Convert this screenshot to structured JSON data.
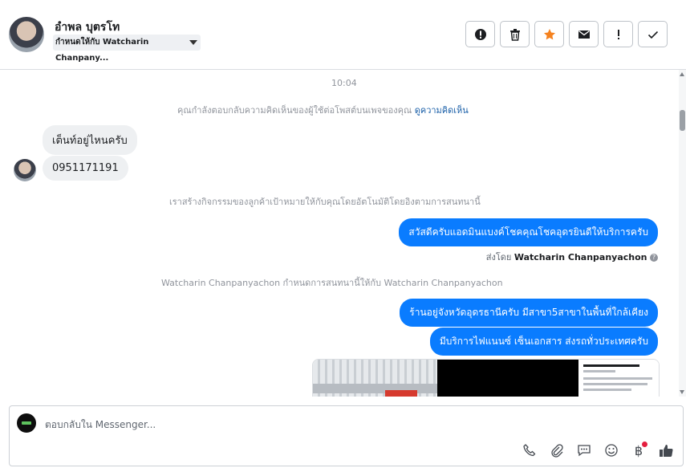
{
  "header": {
    "contact_name": "อำพล บุตรโท",
    "assign_label": "กำหนดให้กับ Watcharin Chanpany...",
    "actions": [
      {
        "name": "spam-button",
        "icon": "alert-circle-icon"
      },
      {
        "name": "delete-button",
        "icon": "trash-icon"
      },
      {
        "name": "follow-up-button",
        "icon": "star-icon"
      },
      {
        "name": "mark-unread-button",
        "icon": "envelope-icon"
      },
      {
        "name": "important-button",
        "icon": "exclamation-icon"
      },
      {
        "name": "done-button",
        "icon": "checkmark-icon"
      }
    ]
  },
  "thread": {
    "timestamp": "10:04",
    "reply_note": "คุณกำลังตอบกลับความคิดเห็นของผู้ใช้ต่อโพสต์บนเพจของคุณ",
    "reply_note_link": "ดูความคิดเห็น",
    "incoming": [
      "เต็นท์อยู่ไหนครับ",
      "0951171191"
    ],
    "activity_note": "เราสร้างกิจกรรมของลูกค้าเป้าหมายให้กับคุณโดยอัตโนมัติโดยอิงตามการสนทนานี้",
    "outgoing_first": "สวัสดีครับแอดมินแบงค์โชคคุณโชคอุดรยินดีให้บริการครับ",
    "sent_by_prefix": "ส่งโดย",
    "sent_by_name": "Watcharin Chanpanyachon",
    "assign_note": "Watcharin Chanpanyachon กำหนดการสนทนานี้ให้กับ Watcharin Chanpanyachon",
    "outgoing_second": "ร้านอยู่จังหวัดอุดรธานีครับ มีสาขา5สาขาในพื้นที่ใกล้เคียง",
    "outgoing_third": "มีบริการไฟแนนซ์ เซ็นเอกสาร ส่งรถทั่วประเทศครับ"
  },
  "composer": {
    "placeholder": "ตอบกลับใน Messenger...",
    "tools": [
      "phone-icon",
      "paperclip-icon",
      "saved-replies-icon",
      "emoji-icon",
      "baht-icon",
      "thumbs-up-icon"
    ],
    "baht_symbol": "฿"
  },
  "colors": {
    "accent": "#0a7cff",
    "star": "#f5821f",
    "link": "#1a5fa8"
  }
}
